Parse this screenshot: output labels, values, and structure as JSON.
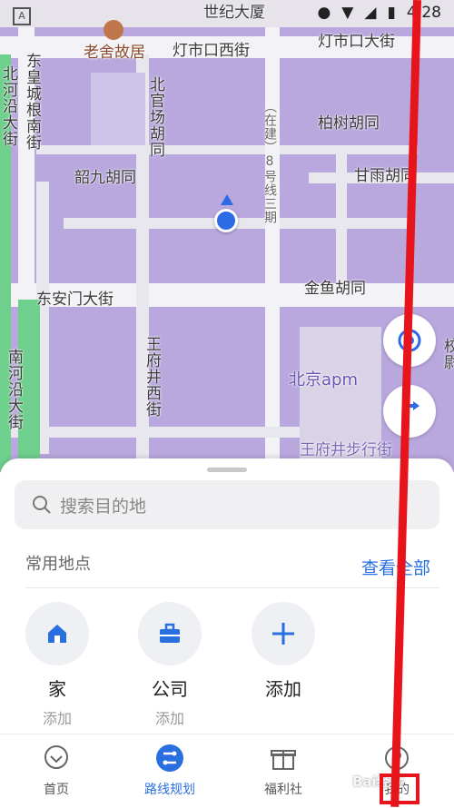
{
  "status": {
    "time": "4:28"
  },
  "map": {
    "labels": {
      "shiji": "世纪大厦",
      "laoshe": "老舍故居",
      "dengshikouxi": "灯市口西街",
      "dengshikoudajie": "灯市口大街",
      "dongcheng": "东皇城根南街",
      "beiheyan": "北河沿大街",
      "beiguanchang": "北官场胡同",
      "zaijian": "（在建）8号线三期",
      "baishu": "柏树胡同",
      "shaojiu": "韶九胡同",
      "ganyu": "甘雨胡同",
      "donganmen": "东安门大街",
      "jinyu": "金鱼胡同",
      "wangfujingxi": "王府井西街",
      "nanheyan": "南河沿大街",
      "apm": "北京apm",
      "wangfujingbuxing": "王府井步行街",
      "rightedge": "校尉"
    }
  },
  "sheet": {
    "search_placeholder": "搜索目的地",
    "frequent_title": "常用地点",
    "view_all": "查看全部",
    "places": [
      {
        "name": "家",
        "sub": "添加",
        "icon": "home-icon"
      },
      {
        "name": "公司",
        "sub": "添加",
        "icon": "briefcase-icon"
      },
      {
        "name": "添加",
        "sub": "",
        "icon": "plus-icon"
      }
    ]
  },
  "tabs": [
    {
      "label": "首页",
      "icon": "home-map-icon"
    },
    {
      "label": "路线规划",
      "icon": "route-icon",
      "active": true
    },
    {
      "label": "福利社",
      "icon": "gift-icon"
    },
    {
      "label": "我的",
      "icon": "profile-icon"
    }
  ],
  "colors": {
    "accent": "#2a6fe0",
    "map_area": "#b9a8de",
    "annotation": "#e8141b"
  },
  "watermark": "Bai经验"
}
